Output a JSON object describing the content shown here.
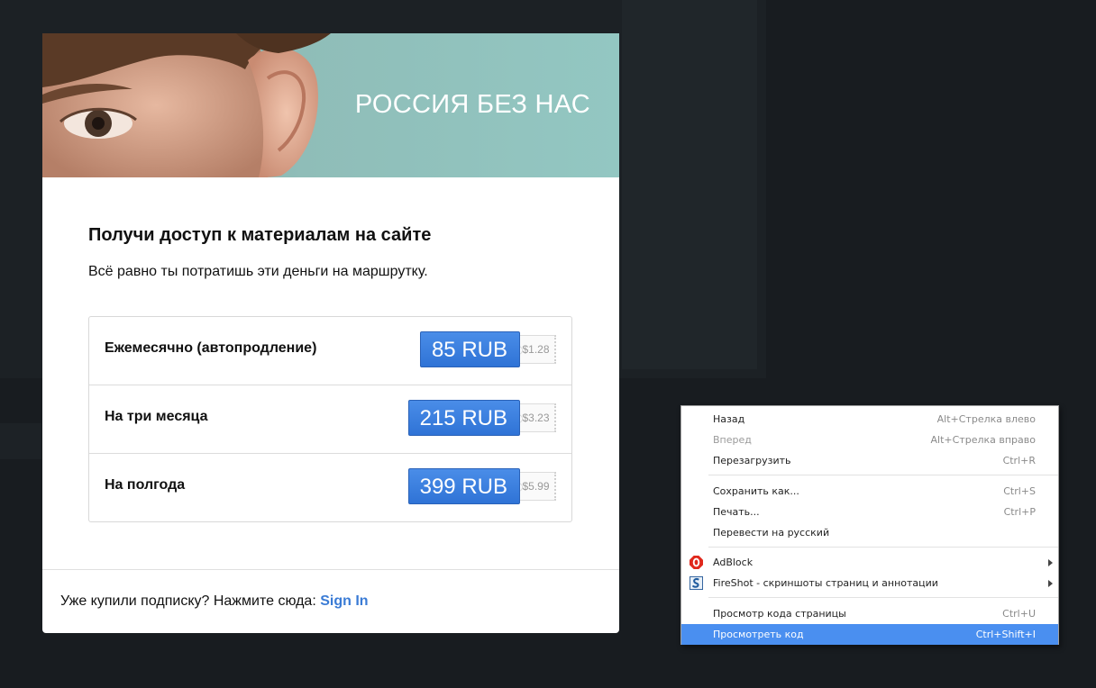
{
  "modal": {
    "hero_title": "РОССИЯ БЕЗ НАС",
    "heading": "Получи доступ к материалам на сайте",
    "subtitle": "Всё равно ты потратишь эти деньги на маршрутку.",
    "plans": [
      {
        "name": "Ежемесячно (автопродление)",
        "price": "85 RUB",
        "usd": "$1.28"
      },
      {
        "name": "На три месяца",
        "price": "215 RUB",
        "usd": "$3.23"
      },
      {
        "name": "На полгода",
        "price": "399 RUB",
        "usd": "$5.99"
      }
    ],
    "footer_text": "Уже купили подписку? Нажмите сюда:",
    "signin_label": "Sign In"
  },
  "context_menu": {
    "items": [
      {
        "label": "Назад",
        "shortcut": "Alt+Стрелка влево"
      },
      {
        "label": "Вперед",
        "shortcut": "Alt+Стрелка вправо"
      },
      {
        "label": "Перезагрузить",
        "shortcut": "Ctrl+R"
      },
      {
        "label": "Сохранить как...",
        "shortcut": "Ctrl+S"
      },
      {
        "label": "Печать...",
        "shortcut": "Ctrl+P"
      },
      {
        "label": "Перевести на русский",
        "shortcut": ""
      },
      {
        "label": "AdBlock",
        "shortcut": ""
      },
      {
        "label": "FireShot - скриншоты страниц и аннотации",
        "shortcut": ""
      },
      {
        "label": "Просмотр кода страницы",
        "shortcut": "Ctrl+U"
      },
      {
        "label": "Просмотреть код",
        "shortcut": "Ctrl+Shift+I"
      }
    ]
  },
  "icons": {
    "adblock": "adblock-icon",
    "fireshot": "fireshot-icon"
  },
  "colors": {
    "accent": "#3a7bd5",
    "button": "#2f73d6",
    "menu_highlight": "#4a8ff0",
    "backdrop": "#181c20"
  }
}
